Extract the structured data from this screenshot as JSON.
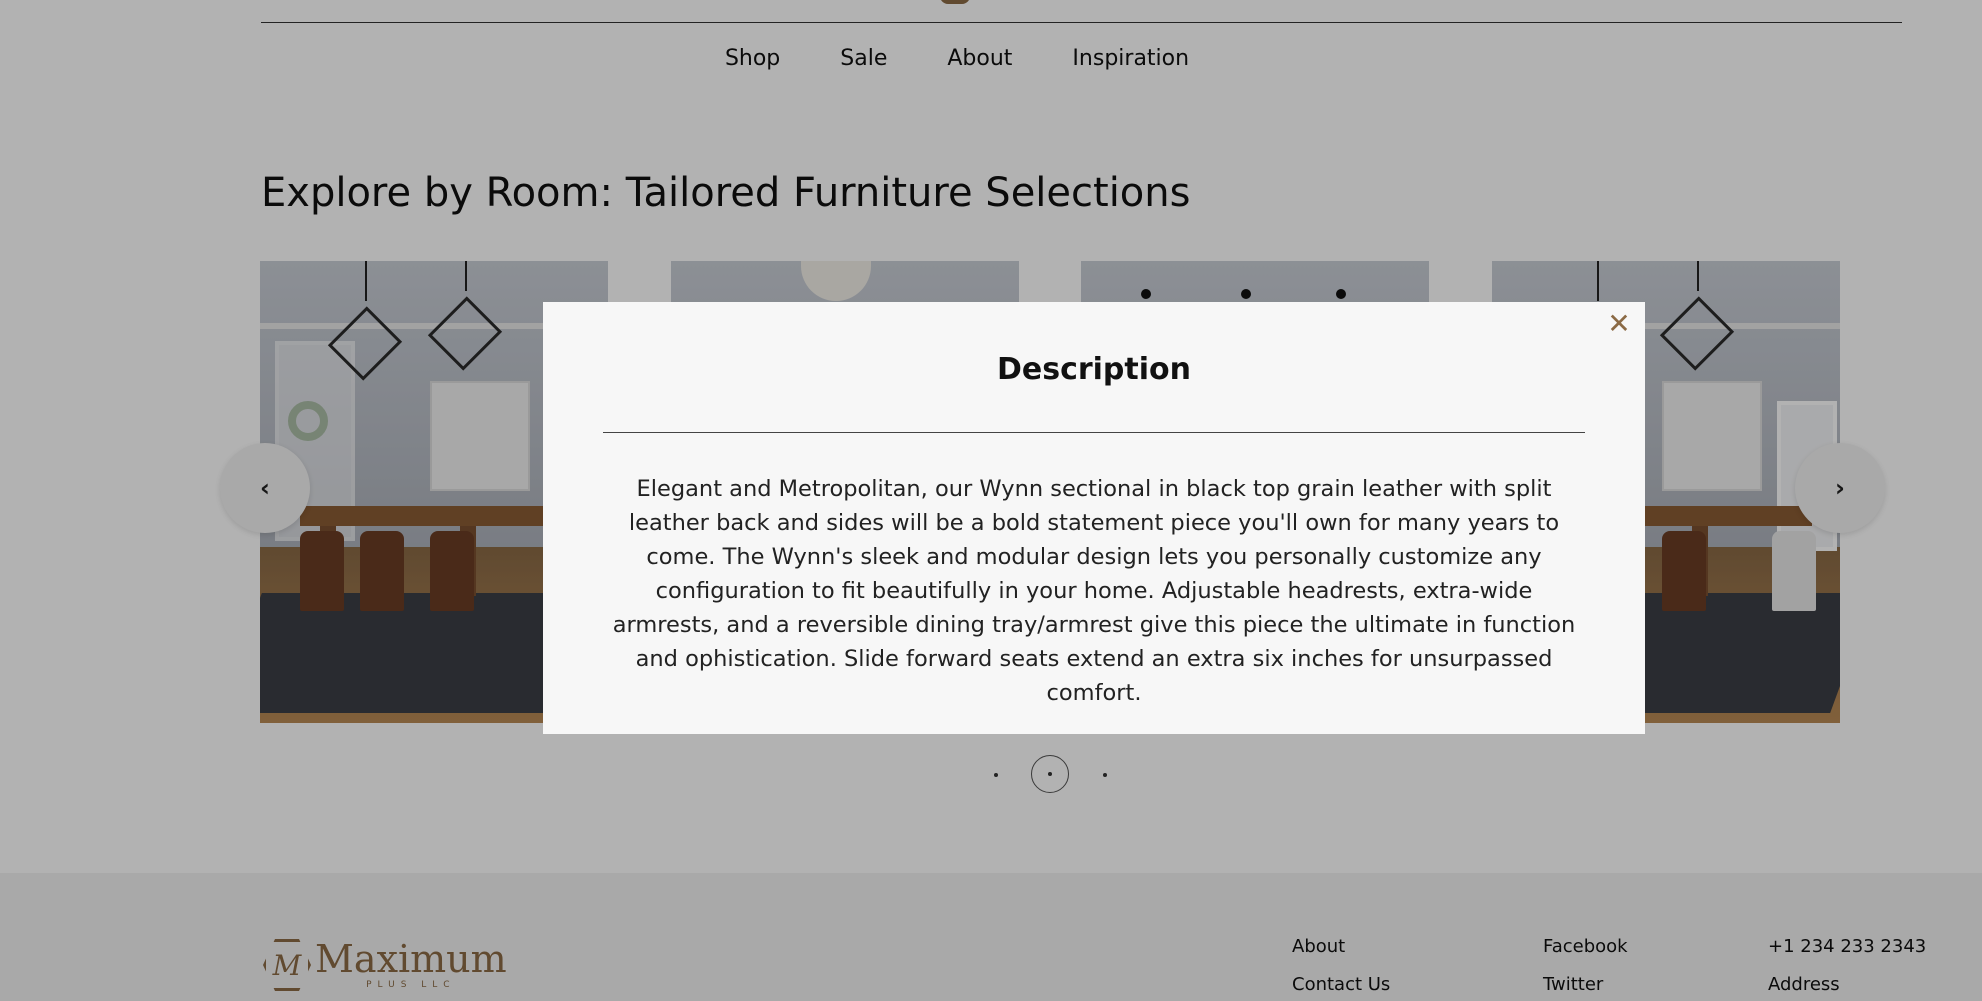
{
  "nav": {
    "items": [
      "Shop",
      "Sale",
      "About",
      "Inspiration"
    ]
  },
  "section": {
    "title": "Explore by Room: Tailored Furniture Selections"
  },
  "carousel": {
    "prev_icon": "chevron-left-icon",
    "next_icon": "chevron-right-icon",
    "prev_glyph": "‹",
    "next_glyph": "›",
    "pagination": {
      "count": 3,
      "active_index": 1
    }
  },
  "modal": {
    "title": "Description",
    "close_glyph": "✕",
    "body": "Elegant and Metropolitan, our Wynn sectional in black top grain leather with split leather back and sides will be a bold statement piece you'll own for many years to come. The Wynn's sleek and modular design lets you personally customize any configuration to fit beautifully in your home. Adjustable headrests, extra-wide armrests, and a reversible dining tray/armrest give this piece the ultimate in function and ophistication. Slide forward seats extend an extra six inches for unsurpassed comfort."
  },
  "brand": {
    "name": "Maximum",
    "sub": "PLUS LLC",
    "monogram": "M",
    "color": "#8b6a45"
  },
  "footer": {
    "col1": [
      "About",
      "Contact Us"
    ],
    "col2": [
      "Facebook",
      "Twitter"
    ],
    "col3": [
      "+1 234 233 2343",
      "Address"
    ]
  },
  "colors": {
    "overlay": "rgba(0,0,0,0.30)",
    "modal_bg": "#f7f7f7",
    "accent": "#8b6a45"
  }
}
